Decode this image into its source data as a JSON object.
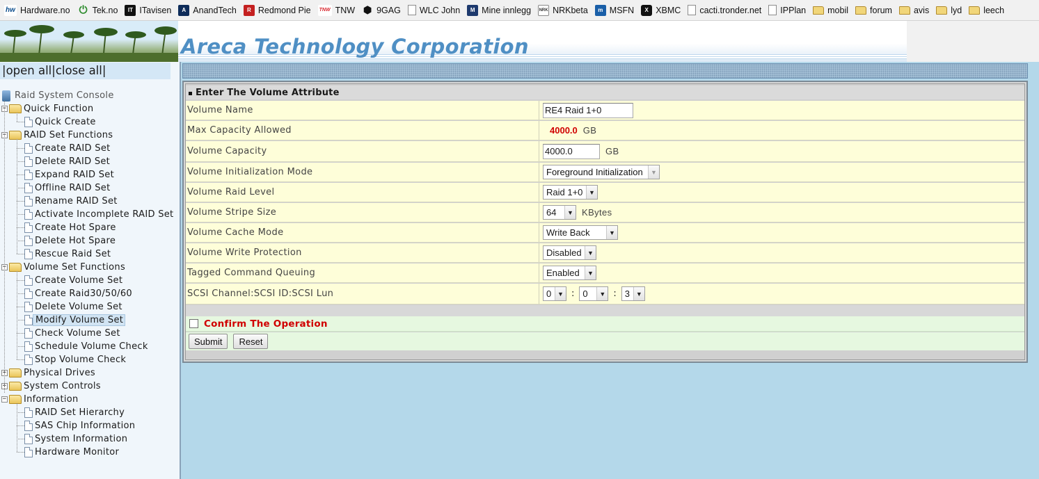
{
  "bookmarks": [
    {
      "label": "Hardware.no",
      "icon": "hardware-no-icon",
      "glyph": "hw"
    },
    {
      "label": "Tek.no",
      "icon": "tek-power-icon",
      "glyph": "⏻"
    },
    {
      "label": "ITavisen",
      "icon": "itavisen-icon",
      "glyph": "IT"
    },
    {
      "label": "AnandTech",
      "icon": "anandtech-icon",
      "glyph": "A"
    },
    {
      "label": "Redmond Pie",
      "icon": "redmond-pie-icon",
      "glyph": "R"
    },
    {
      "label": "TNW",
      "icon": "tnw-icon",
      "glyph": "TNW"
    },
    {
      "label": "9GAG",
      "icon": "9gag-icon",
      "glyph": "⬢"
    },
    {
      "label": "WLC John",
      "icon": "page-icon",
      "glyph": ""
    },
    {
      "label": "Mine innlegg",
      "icon": "mine-innlegg-icon",
      "glyph": "M"
    },
    {
      "label": "NRKbeta",
      "icon": "nrkbeta-icon",
      "glyph": "NRK"
    },
    {
      "label": "MSFN",
      "icon": "msfn-icon",
      "glyph": "m"
    },
    {
      "label": "XBMC",
      "icon": "xbmc-icon",
      "glyph": "X"
    },
    {
      "label": "cacti.tronder.net",
      "icon": "page-icon",
      "glyph": ""
    },
    {
      "label": "IPPlan",
      "icon": "page-icon",
      "glyph": ""
    },
    {
      "label": "mobil",
      "icon": "folder-icon",
      "glyph": ""
    },
    {
      "label": "forum",
      "icon": "folder-icon",
      "glyph": ""
    },
    {
      "label": "avis",
      "icon": "folder-icon",
      "glyph": ""
    },
    {
      "label": "lyd",
      "icon": "folder-icon",
      "glyph": ""
    },
    {
      "label": "leech",
      "icon": "folder-icon",
      "glyph": ""
    }
  ],
  "header": {
    "brand": "Areca Technology Corporation"
  },
  "sidebar": {
    "bar_left": "|",
    "open_all": "open all",
    "bar_mid": "|",
    "close_all": "close all",
    "bar_right": "|",
    "root": "Raid System Console",
    "groups": [
      {
        "label": "Quick Function",
        "expanded": true,
        "items": [
          "Quick Create"
        ]
      },
      {
        "label": "RAID Set Functions",
        "expanded": true,
        "items": [
          "Create RAID Set",
          "Delete RAID Set",
          "Expand RAID Set",
          "Offline RAID Set",
          "Rename RAID Set",
          "Activate Incomplete RAID Set",
          "Create Hot Spare",
          "Delete Hot Spare",
          "Rescue Raid Set"
        ]
      },
      {
        "label": "Volume Set Functions",
        "expanded": true,
        "items": [
          "Create Volume Set",
          "Create Raid30/50/60",
          "Delete Volume Set",
          "Modify Volume Set",
          "Check Volume Set",
          "Schedule Volume Check",
          "Stop Volume Check"
        ]
      },
      {
        "label": "Physical Drives",
        "expanded": false,
        "items": []
      },
      {
        "label": "System Controls",
        "expanded": false,
        "items": []
      },
      {
        "label": "Information",
        "expanded": true,
        "items": [
          "RAID Set Hierarchy",
          "SAS Chip Information",
          "System Information",
          "Hardware Monitor"
        ]
      }
    ],
    "selected": "Modify Volume Set"
  },
  "form": {
    "title": "Enter The Volume Attribute",
    "volume_name": {
      "label": "Volume Name",
      "value": "RE4 Raid 1+0"
    },
    "max_capacity": {
      "label": "Max Capacity Allowed",
      "value": "4000.0",
      "unit": "GB"
    },
    "volume_capacity": {
      "label": "Volume Capacity",
      "value": "4000.0",
      "unit": "GB"
    },
    "init_mode": {
      "label": "Volume Initialization Mode",
      "value": "Foreground Initialization"
    },
    "raid_level": {
      "label": "Volume Raid Level",
      "value": "Raid 1+0"
    },
    "stripe_size": {
      "label": "Volume Stripe Size",
      "value": "64",
      "unit": "KBytes"
    },
    "cache_mode": {
      "label": "Volume Cache Mode",
      "value": "Write Back"
    },
    "write_protection": {
      "label": "Volume Write Protection",
      "value": "Disabled"
    },
    "tcq": {
      "label": "Tagged Command Queuing",
      "value": "Enabled"
    },
    "scsi": {
      "label": "SCSI Channel:SCSI ID:SCSI Lun",
      "channel": "0",
      "id": "0",
      "lun": "3",
      "sep": ":"
    },
    "confirm": "Confirm The Operation",
    "submit": "Submit",
    "reset": "Reset"
  },
  "colors": {
    "accent_blue": "#4f8fc4",
    "warning_red": "#d00000",
    "row_bg": "#fefed9",
    "confirm_bg": "#e6f8e0",
    "page_bg": "#b4d8ea"
  }
}
